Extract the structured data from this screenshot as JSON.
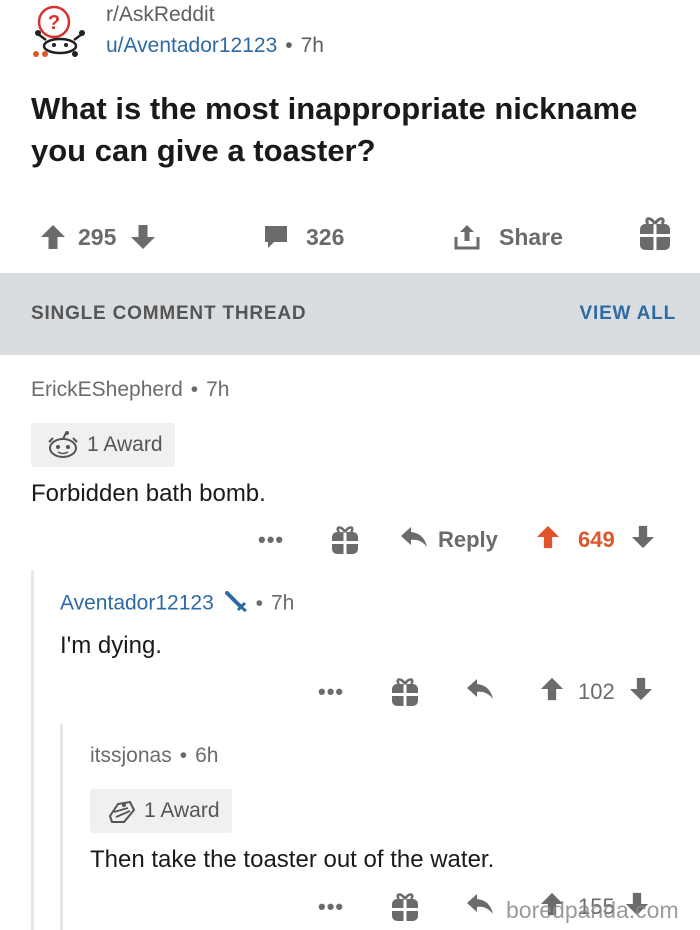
{
  "post": {
    "subreddit": "r/AskReddit",
    "author": "u/Aventador12123",
    "age": "7h",
    "title": "What is the most inappropriate nickname you can give a toaster?",
    "score": "295",
    "comments": "326",
    "share_label": "Share"
  },
  "thread": {
    "label": "SINGLE COMMENT THREAD",
    "view_all": "VIEW ALL"
  },
  "comments": [
    {
      "author": "ErickEShepherd",
      "age": "7h",
      "award": "1 Award",
      "body": "Forbidden bath bomb.",
      "more": "•••",
      "reply_label": "Reply",
      "score": "649",
      "upvoted": true
    },
    {
      "author": "Aventador12123",
      "age": "7h",
      "body": "I'm dying.",
      "more": "•••",
      "score": "102"
    },
    {
      "author": "itssjonas",
      "age": "6h",
      "award": "1 Award",
      "body": "Then take the toaster out of the water.",
      "more": "•••",
      "score": "155"
    }
  ],
  "watermark": "boredpanda.com",
  "colors": {
    "upvoted": "#e0542a",
    "link": "#2d6aa3",
    "thread_bar": "#dadde0",
    "muted": "#6b6b6b"
  },
  "icons": [
    "askreddit-snoo-icon",
    "upvote-icon",
    "downvote-icon",
    "comment-icon",
    "share-icon",
    "gift-icon",
    "award-icon",
    "reply-icon",
    "mod-sword-icon"
  ]
}
